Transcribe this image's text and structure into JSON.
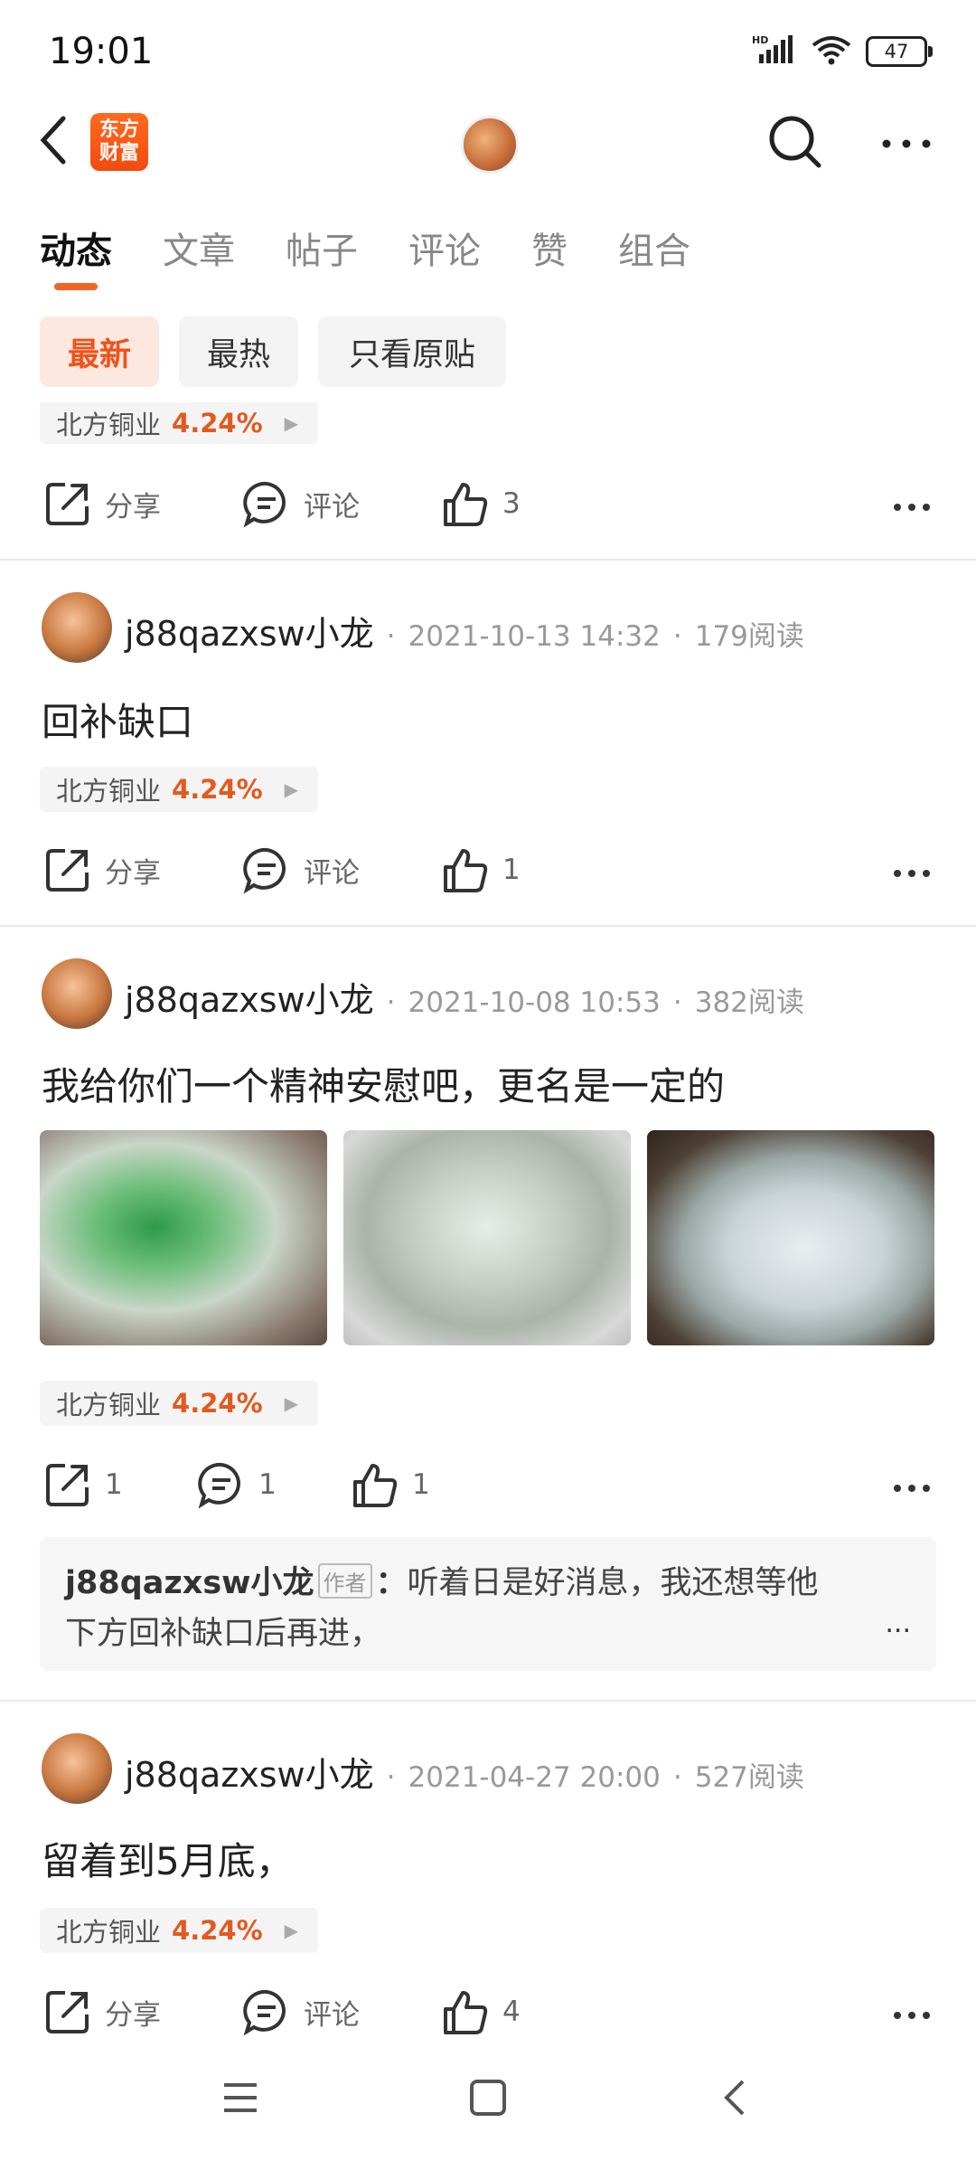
{
  "status": {
    "time": "19:01",
    "battery": "47",
    "network": "HD"
  },
  "header": {
    "logo_line1": "东方",
    "logo_line2": "财富"
  },
  "tabs": [
    {
      "label": "动态",
      "active": true
    },
    {
      "label": "文章"
    },
    {
      "label": "帖子"
    },
    {
      "label": "评论"
    },
    {
      "label": "赞"
    },
    {
      "label": "组合"
    }
  ],
  "filters": [
    {
      "label": "最新",
      "active": true
    },
    {
      "label": "最热"
    },
    {
      "label": "只看原贴"
    }
  ],
  "share_label": "分享",
  "comment_label": "评论",
  "stock": {
    "name": "北方铜业",
    "change": "4.24%"
  },
  "posts": [
    {
      "likes": "3"
    },
    {
      "author": "j88qazxsw小龙",
      "date": "2021-10-13 14:32",
      "reads": "179阅读",
      "text": "回补缺口",
      "likes": "1"
    },
    {
      "author": "j88qazxsw小龙",
      "date": "2021-10-08 10:53",
      "reads": "382阅读",
      "text": "我给你们一个精神安慰吧，更名是一定的",
      "shares": "1",
      "comments": "1",
      "likes": "1",
      "comment": {
        "author": "j88qazxsw小龙",
        "badge": "作者",
        "colon": "：",
        "text1": "听着日是好消息，我还想等他",
        "text2": "下方回补缺口后再进，",
        "more": "..."
      }
    },
    {
      "author": "j88qazxsw小龙",
      "date": "2021-04-27 20:00",
      "reads": "527阅读",
      "text": "留着到5月底，",
      "likes": "4"
    }
  ],
  "dot": "·"
}
